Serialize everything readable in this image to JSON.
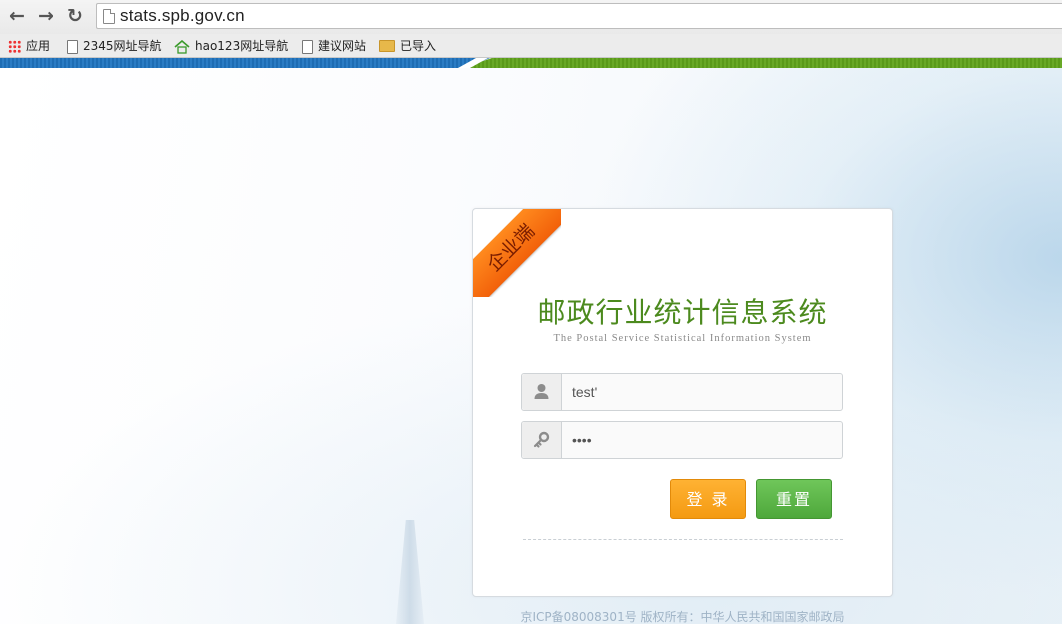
{
  "browser": {
    "url": "stats.spb.gov.cn",
    "bookmarks": [
      {
        "label": "应用",
        "icon": "apps-grid-icon"
      },
      {
        "label": "2345网址导航",
        "icon": "page-icon"
      },
      {
        "label": "hao123网址导航",
        "icon": "house-icon"
      },
      {
        "label": "建议网站",
        "icon": "page-icon"
      },
      {
        "label": "已导入",
        "icon": "folder-icon"
      }
    ]
  },
  "login": {
    "ribbon": "企业端",
    "title": "邮政行业统计信息系统",
    "subtitle": "The Postal Service Statistical Information System",
    "username_value": "test'",
    "password_value": "••••",
    "login_label": "登 录",
    "reset_label": "重置"
  },
  "footer": {
    "text": "京ICP备08008301号 版权所有：中华人民共和国国家邮政局"
  },
  "colors": {
    "title": "#4c8a1e",
    "login_button": "#f49a12",
    "reset_button": "#4ea83b",
    "ribbon": "#f2610a",
    "stripe_blue": "#1e6db4",
    "stripe_green": "#5a9a1a"
  }
}
